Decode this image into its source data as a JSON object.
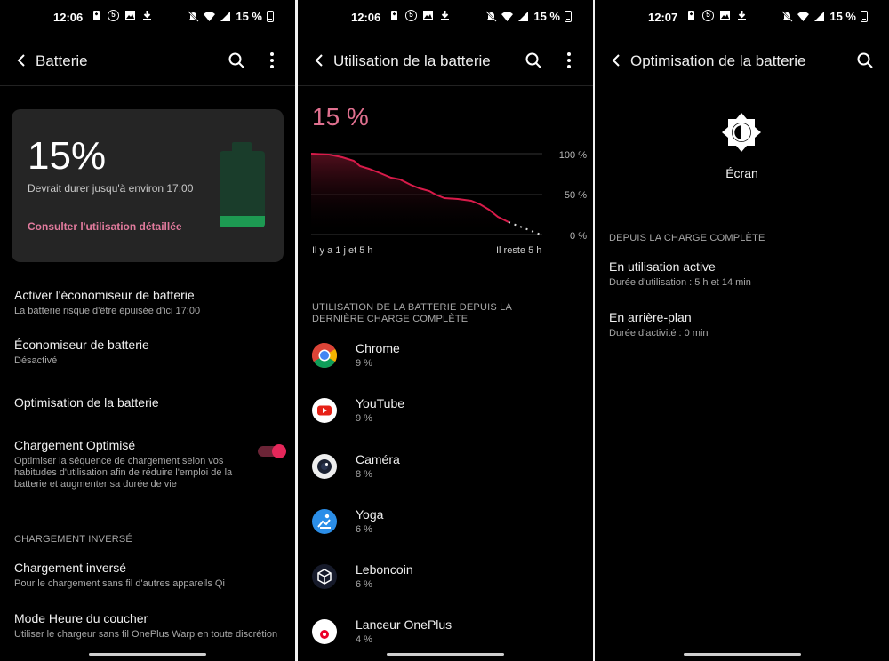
{
  "status_bars": [
    {
      "time": "12:06",
      "battery": "15 %"
    },
    {
      "time": "12:06",
      "battery": "15 %"
    },
    {
      "time": "12:07",
      "battery": "15 %"
    }
  ],
  "screen1": {
    "title": "Batterie",
    "card": {
      "percent": "15%",
      "estimate": "Devrait durer jusqu'à environ 17:00",
      "link": "Consulter l'utilisation détaillée",
      "level": 0.15,
      "colors": {
        "empty": "#1a3d2b",
        "fill": "#1d9a52"
      }
    },
    "items": [
      {
        "title": "Activer l'économiseur de batterie",
        "sub": "La batterie risque d'être épuisée d'ici 17:00"
      },
      {
        "title": "Économiseur de batterie",
        "sub": "Désactivé"
      },
      {
        "title": "Optimisation de la batterie",
        "sub": ""
      },
      {
        "title": "Chargement Optimisé",
        "sub": "Optimiser la séquence de chargement selon vos habitudes d'utilisation afin de réduire l'emploi de la batterie et augmenter sa durée de vie",
        "toggle_on": true
      },
      {
        "title": "Chargement inversé",
        "sub": "Pour le chargement sans fil d'autres appareils Qi"
      },
      {
        "title": "Mode Heure du coucher",
        "sub": "Utiliser le chargeur sans fil OnePlus Warp en toute discrétion"
      }
    ],
    "section_reverse": "CHARGEMENT INVERSÉ"
  },
  "screen2": {
    "title": "Utilisation de la batterie",
    "percent": "15 %",
    "chart_labels": {
      "y_top": "100 %",
      "y_mid": "50 %",
      "y_bottom": "0 %",
      "x_left": "Il y a 1 j et 5 h",
      "x_right": "Il reste 5 h"
    },
    "section": "UTILISATION DE LA BATTERIE DEPUIS LA DERNIÈRE CHARGE COMPLÈTE",
    "apps": [
      {
        "name": "Chrome",
        "pct": "9 %",
        "icon": "chrome-icon"
      },
      {
        "name": "YouTube",
        "pct": "9 %",
        "icon": "youtube-icon"
      },
      {
        "name": "Caméra",
        "pct": "8 %",
        "icon": "camera-icon"
      },
      {
        "name": "Yoga",
        "pct": "6 %",
        "icon": "yoga-icon"
      },
      {
        "name": "Leboncoin",
        "pct": "6 %",
        "icon": "leboncoin-icon"
      },
      {
        "name": "Lanceur OnePlus",
        "pct": "4 %",
        "icon": "oneplus-launcher-icon"
      }
    ],
    "accent": "#e0708f",
    "line_color": "#d81b4a"
  },
  "screen3": {
    "title": "Optimisation de la batterie",
    "component": "Écran",
    "section": "DEPUIS LA CHARGE COMPLÈTE",
    "items": [
      {
        "title": "En utilisation active",
        "sub": "Durée d'utilisation : 5 h et 14 min"
      },
      {
        "title": "En arrière-plan",
        "sub": "Durée d'activité : 0 min"
      }
    ]
  }
}
